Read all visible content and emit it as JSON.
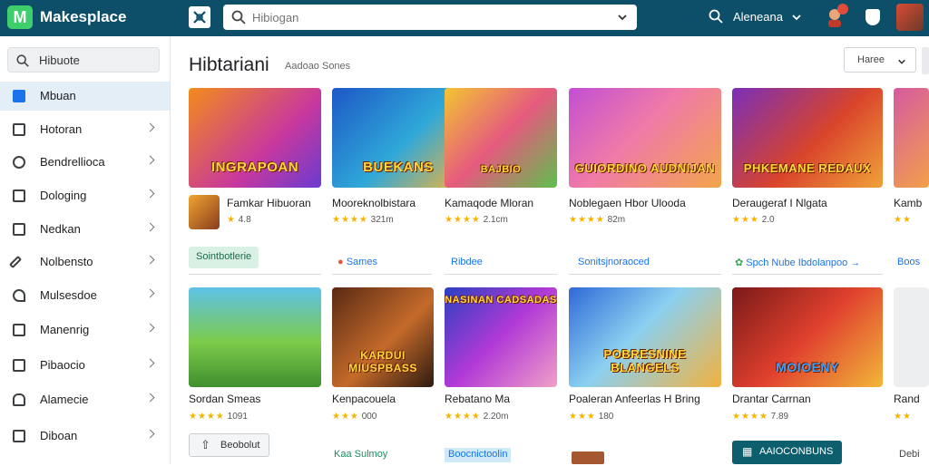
{
  "app": {
    "name": "Makesplace"
  },
  "colors": {
    "topbar": "#0d4f68",
    "brand_green": "#3ecf6c",
    "accent_blue": "#1a73e8",
    "star": "#f4b400"
  },
  "topbar": {
    "search_placeholder": "Hibiogan",
    "account_label": "Aleneana"
  },
  "sidebar": {
    "search_label": "Hibuote",
    "items": [
      {
        "label": "Mbuan",
        "icon": "home-icon",
        "active": true
      },
      {
        "label": "Hotoran",
        "icon": "bookmark-icon"
      },
      {
        "label": "Bendrellioca",
        "icon": "target-icon"
      },
      {
        "label": "Dologing",
        "icon": "photo-icon"
      },
      {
        "label": "Nedkan",
        "icon": "puzzle-icon"
      },
      {
        "label": "Nolbensto",
        "icon": "pencil-icon"
      },
      {
        "label": "Mulsesdoe",
        "icon": "wrench-icon"
      },
      {
        "label": "Manenrig",
        "icon": "chart-icon"
      },
      {
        "label": "Pibaocio",
        "icon": "tag-icon"
      },
      {
        "label": "Alamecie",
        "icon": "bell-icon"
      },
      {
        "label": "Diboan",
        "icon": "mail-icon"
      }
    ]
  },
  "main": {
    "title": "Hibtariani",
    "subtitle": "Aadoao Sones",
    "sort_label": "Haree",
    "row1": [
      {
        "thumb_title": "INGRAPOAN",
        "name": "Famkar Hibuoran",
        "rating": "4.8"
      },
      {
        "thumb_title": "BUEKANS",
        "name": "Mooreknolbistara",
        "rating": "321m"
      },
      {
        "thumb_title": "BAJBIO",
        "name": "Kamaqode Mloran",
        "rating": "2.1cm"
      },
      {
        "thumb_title": "GUIORDINO AUDNIJAN",
        "name": "Noblegaen Hbor Ulooda",
        "rating": "82m"
      },
      {
        "thumb_title": "PHKEMANE REDAUX",
        "name": "Deraugeraf I Nlgata",
        "rating": "2.0"
      },
      {
        "thumb_title": "",
        "name": "Kamb",
        "rating": ""
      }
    ],
    "chips": [
      {
        "label": "Sointbotlerie"
      },
      {
        "label": "Sames"
      },
      {
        "label": "Ribdee"
      },
      {
        "label": "Sonitsjnoraoced"
      },
      {
        "label": "Spch Nube Ibdolanpoo"
      },
      {
        "label": "Boos"
      }
    ],
    "row2": [
      {
        "thumb_title": "",
        "name": "Sordan Smeas",
        "rating": "1091"
      },
      {
        "thumb_title": "KARDUI MIUSPBASS",
        "name": "Kenpacouela",
        "rating": "000"
      },
      {
        "thumb_title": "NASINAN CADSADAS",
        "name": "Rebatano Ma",
        "rating": "2.20m"
      },
      {
        "thumb_title": "POBRESNINE BLANGELS",
        "name": "Poaleran Anfeerlas H Bring",
        "rating": "180"
      },
      {
        "thumb_title": "MOIOENY",
        "name": "Drantar Carrnan",
        "rating": "7.89"
      },
      {
        "thumb_title": "",
        "name": "Rand",
        "rating": ""
      }
    ],
    "row2_actions": [
      {
        "label": "Beobolut"
      },
      {
        "label": "Kaa Sulmoy"
      },
      {
        "label": "Boocnictoolin"
      },
      {
        "label": ""
      },
      {
        "label": "AAIOCONBUNS"
      },
      {
        "label": "Debi"
      }
    ]
  }
}
